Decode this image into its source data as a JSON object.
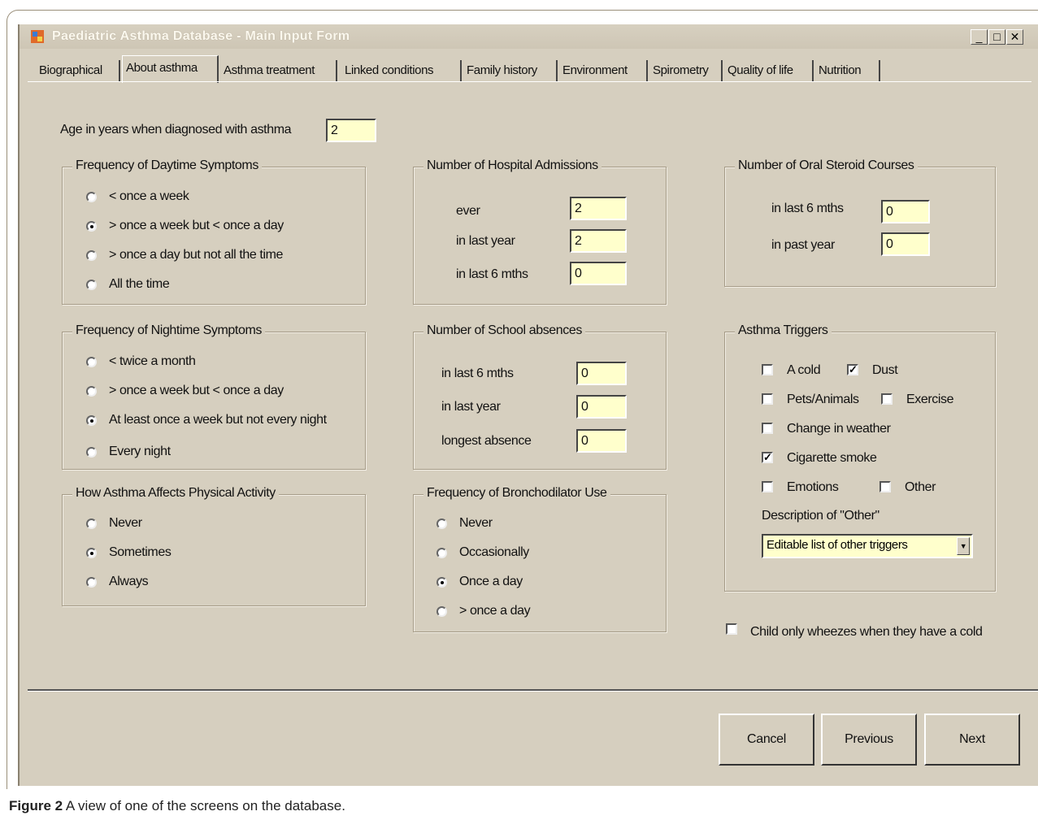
{
  "window": {
    "title": "Paediatric Asthma Database - Main Input Form",
    "minimize": "_",
    "maximize": "□",
    "close": "✕"
  },
  "tabs": [
    "Biographical",
    "About asthma",
    "Asthma treatment",
    "Linked conditions",
    "Family history",
    "Environment",
    "Spirometry",
    "Quality of life",
    "Nutrition"
  ],
  "active_tab": "About asthma",
  "age": {
    "label": "Age in years when diagnosed with asthma",
    "value": "2"
  },
  "daytime": {
    "title": "Frequency of Daytime Symptoms",
    "options": [
      "< once a week",
      "> once a week but < once a day",
      "> once a day but not all the time",
      "All the time"
    ],
    "selected": 1
  },
  "nighttime": {
    "title": "Frequency of Nightime Symptoms",
    "options": [
      "< twice a month",
      "> once a week but < once a day",
      "At least once a week but not every night",
      "Every night"
    ],
    "selected": 2
  },
  "physical": {
    "title": "How Asthma Affects Physical Activity",
    "options": [
      "Never",
      "Sometimes",
      "Always"
    ],
    "selected": 1
  },
  "hospital": {
    "title": "Number of Hospital Admissions",
    "rows": [
      {
        "label": "ever",
        "value": "2"
      },
      {
        "label": "in last year",
        "value": "2"
      },
      {
        "label": "in last 6 mths",
        "value": "0"
      }
    ]
  },
  "school": {
    "title": "Number of School absences",
    "rows": [
      {
        "label": "in last 6 mths",
        "value": "0"
      },
      {
        "label": "in last year",
        "value": "0"
      },
      {
        "label": "longest absence",
        "value": "0"
      }
    ]
  },
  "broncho": {
    "title": "Frequency of Bronchodilator Use",
    "options": [
      "Never",
      "Occasionally",
      "Once a day",
      "> once a day"
    ],
    "selected": 2
  },
  "steroid": {
    "title": "Number of Oral Steroid Courses",
    "rows": [
      {
        "label": "in last 6 mths",
        "value": "0"
      },
      {
        "label": "in past year",
        "value": "0"
      }
    ]
  },
  "triggers": {
    "title": "Asthma Triggers",
    "items": [
      {
        "label": "A cold",
        "checked": false
      },
      {
        "label": "Dust",
        "checked": true
      },
      {
        "label": "Pets/Animals",
        "checked": false
      },
      {
        "label": "Exercise",
        "checked": false
      },
      {
        "label": "Change in weather",
        "checked": false
      },
      {
        "label": "Cigarette smoke",
        "checked": true
      },
      {
        "label": "Emotions",
        "checked": false
      },
      {
        "label": "Other",
        "checked": false
      }
    ],
    "other_label": "Description of \"Other\"",
    "other_value": "Editable list of other triggers"
  },
  "wheeze": {
    "label": "Child only wheezes when they have a cold",
    "checked": false
  },
  "buttons": {
    "cancel": "Cancel",
    "previous": "Previous",
    "next": "Next"
  },
  "caption": {
    "bold": "Figure 2",
    "text": "A view of one of the screens on the database."
  }
}
